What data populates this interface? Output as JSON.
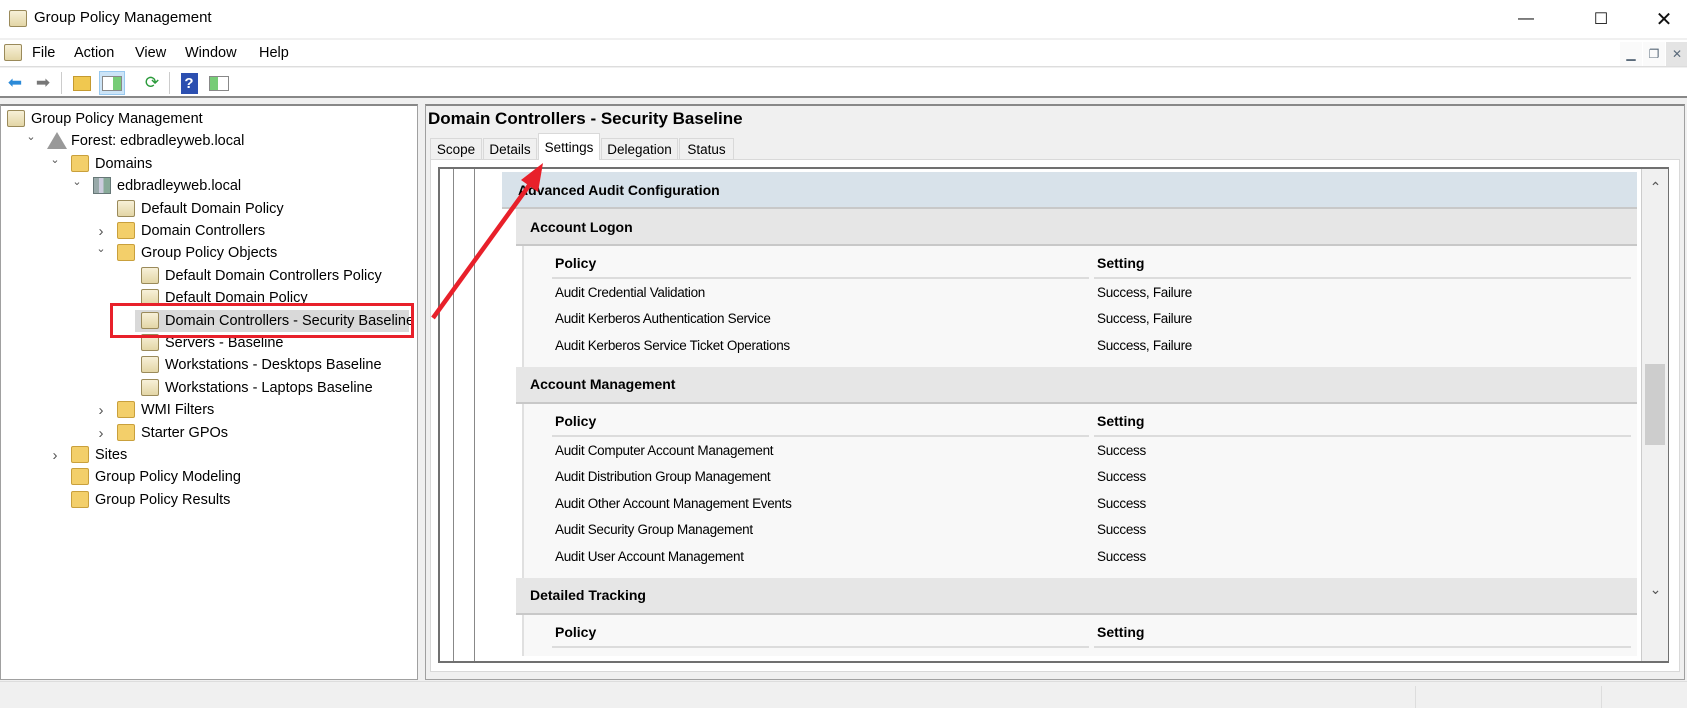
{
  "window": {
    "title": "Group Policy Management"
  },
  "menu": [
    "File",
    "Action",
    "View",
    "Window",
    "Help"
  ],
  "toolbar": [
    {
      "name": "back",
      "glyph": "⬅",
      "color": "#2b8ad8"
    },
    {
      "name": "forward",
      "glyph": "➡",
      "color": "#777"
    },
    {
      "name": "up-folder",
      "glyph": "📁",
      "color": "#d9a520"
    },
    {
      "name": "show-hide-console-tree",
      "glyph": "▤",
      "color": "#3a7"
    },
    {
      "name": "refresh",
      "glyph": "⟳",
      "color": "#2a9a3a"
    },
    {
      "name": "help",
      "glyph": "?",
      "color": "#fff"
    },
    {
      "name": "show-hide-action-pane",
      "glyph": "▥",
      "color": "#3a7"
    }
  ],
  "tree": [
    {
      "label": "Group Policy Management",
      "level": 0,
      "expander": "",
      "icon": "scroll"
    },
    {
      "label": "Forest: edbradleyweb.local",
      "level": 1,
      "expander": "expanded",
      "icon": "forest"
    },
    {
      "label": "Domains",
      "level": 2,
      "expander": "expanded",
      "icon": "folder"
    },
    {
      "label": "edbradleyweb.local",
      "level": 3,
      "expander": "expanded",
      "icon": "server"
    },
    {
      "label": "Default Domain Policy",
      "level": 4,
      "expander": "",
      "icon": "scroll"
    },
    {
      "label": "Domain Controllers",
      "level": 4,
      "expander": "collapsed",
      "icon": "folder"
    },
    {
      "label": "Group Policy Objects",
      "level": 4,
      "expander": "expanded",
      "icon": "folder"
    },
    {
      "label": "Default Domain Controllers Policy",
      "level": 5,
      "expander": "",
      "icon": "scroll"
    },
    {
      "label": "Default Domain Policy",
      "level": 5,
      "expander": "",
      "icon": "scroll"
    },
    {
      "label": "Domain Controllers - Security Baseline",
      "level": 5,
      "expander": "",
      "icon": "scroll",
      "selected": true
    },
    {
      "label": "Servers - Baseline",
      "level": 5,
      "expander": "",
      "icon": "scroll"
    },
    {
      "label": "Workstations - Desktops Baseline",
      "level": 5,
      "expander": "",
      "icon": "scroll"
    },
    {
      "label": "Workstations - Laptops Baseline",
      "level": 5,
      "expander": "",
      "icon": "scroll"
    },
    {
      "label": "WMI Filters",
      "level": 4,
      "expander": "collapsed",
      "icon": "folder"
    },
    {
      "label": "Starter GPOs",
      "level": 4,
      "expander": "collapsed",
      "icon": "folder"
    },
    {
      "label": "Sites",
      "level": 2,
      "expander": "collapsed",
      "icon": "folder"
    },
    {
      "label": "Group Policy Modeling",
      "level": 2,
      "expander": "",
      "icon": "folder"
    },
    {
      "label": "Group Policy Results",
      "level": 2,
      "expander": "",
      "icon": "folder"
    }
  ],
  "details": {
    "title": "Domain Controllers - Security Baseline",
    "tabs": [
      "Scope",
      "Details",
      "Settings",
      "Delegation",
      "Status"
    ],
    "active_tab": "Settings",
    "root_section": "Advanced Audit Configuration",
    "sections": [
      {
        "title": "Account Logon",
        "columns": [
          "Policy",
          "Setting"
        ],
        "rows": [
          [
            "Audit Credential Validation",
            "Success, Failure"
          ],
          [
            "Audit Kerberos Authentication Service",
            "Success, Failure"
          ],
          [
            "Audit Kerberos Service Ticket Operations",
            "Success, Failure"
          ]
        ]
      },
      {
        "title": "Account Management",
        "columns": [
          "Policy",
          "Setting"
        ],
        "rows": [
          [
            "Audit Computer Account Management",
            "Success"
          ],
          [
            "Audit Distribution Group Management",
            "Success"
          ],
          [
            "Audit Other Account Management Events",
            "Success"
          ],
          [
            "Audit Security Group Management",
            "Success"
          ],
          [
            "Audit User Account Management",
            "Success"
          ]
        ]
      },
      {
        "title": "Detailed Tracking",
        "columns": [
          "Policy",
          "Setting"
        ],
        "rows": []
      }
    ]
  },
  "scrollbar": {
    "position_fraction": 0.47
  },
  "annotation_color": "#e8202a"
}
